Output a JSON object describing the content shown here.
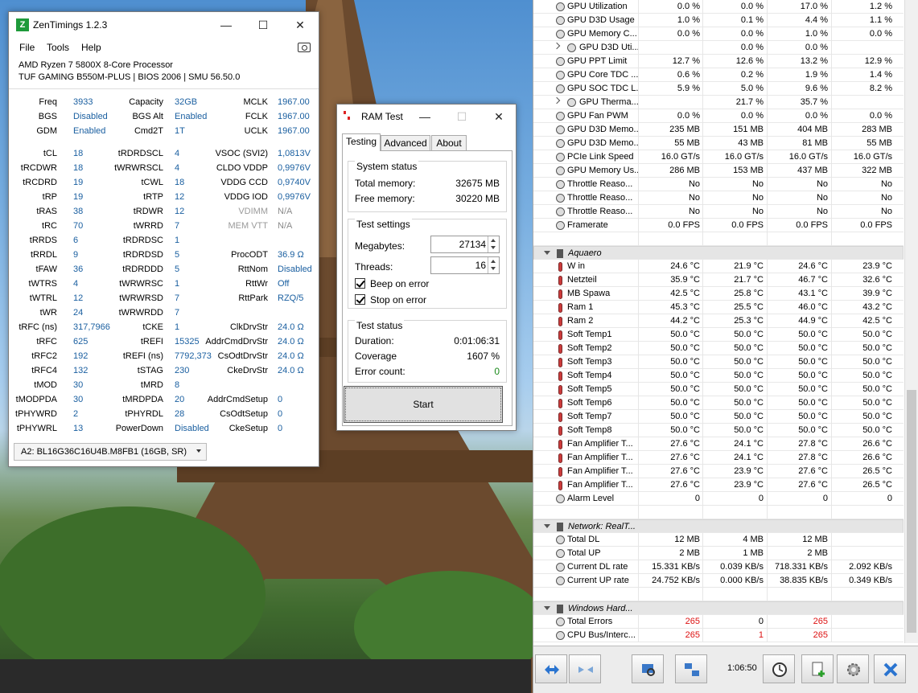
{
  "zen": {
    "title": "ZenTimings 1.2.3",
    "icon_letter": "Z",
    "menu": [
      "File",
      "Tools",
      "Help"
    ],
    "cpu": "AMD Ryzen 7 5800X 8-Core Processor",
    "board": "TUF GAMING B550M-PLUS | BIOS 2006 | SMU 56.50.0",
    "rows": [
      [
        "Freq",
        "3933",
        "Capacity",
        "32GB",
        "MCLK",
        "1967.00"
      ],
      [
        "BGS",
        "Disabled",
        "BGS Alt",
        "Enabled",
        "FCLK",
        "1967.00"
      ],
      [
        "GDM",
        "Enabled",
        "Cmd2T",
        "1T",
        "UCLK",
        "1967.00"
      ],
      [
        "tCL",
        "18",
        "tRDRDSCL",
        "4",
        "VSOC (SVI2)",
        "1,0813V"
      ],
      [
        "tRCDWR",
        "18",
        "tWRWRSCL",
        "4",
        "CLDO VDDP",
        "0,9976V"
      ],
      [
        "tRCDRD",
        "19",
        "tCWL",
        "18",
        "VDDG CCD",
        "0,9740V"
      ],
      [
        "tRP",
        "19",
        "tRTP",
        "12",
        "VDDG IOD",
        "0,9976V"
      ],
      [
        "tRAS",
        "38",
        "tRDWR",
        "12",
        "VDIMM",
        "N/A"
      ],
      [
        "tRC",
        "70",
        "tWRRD",
        "7",
        "MEM VTT",
        "N/A"
      ],
      [
        "tRRDS",
        "6",
        "tRDRDSC",
        "1",
        "",
        ""
      ],
      [
        "tRRDL",
        "9",
        "tRDRDSD",
        "5",
        "ProcODT",
        "36.9 Ω"
      ],
      [
        "tFAW",
        "36",
        "tRDRDDD",
        "5",
        "RttNom",
        "Disabled"
      ],
      [
        "tWTRS",
        "4",
        "tWRWRSC",
        "1",
        "RttWr",
        "Off"
      ],
      [
        "tWTRL",
        "12",
        "tWRWRSD",
        "7",
        "RttPark",
        "RZQ/5"
      ],
      [
        "tWR",
        "24",
        "tWRWRDD",
        "7",
        "",
        ""
      ],
      [
        "tRFC (ns)",
        "317,7966",
        "tCKE",
        "1",
        "ClkDrvStr",
        "24.0 Ω"
      ],
      [
        "tRFC",
        "625",
        "tREFI",
        "15325",
        "AddrCmdDrvStr",
        "24.0 Ω"
      ],
      [
        "tRFC2",
        "192",
        "tREFI (ns)",
        "7792,373",
        "CsOdtDrvStr",
        "24.0 Ω"
      ],
      [
        "tRFC4",
        "132",
        "tSTAG",
        "230",
        "CkeDrvStr",
        "24.0 Ω"
      ],
      [
        "tMOD",
        "30",
        "tMRD",
        "8",
        "",
        ""
      ],
      [
        "tMODPDA",
        "30",
        "tMRDPDA",
        "20",
        "AddrCmdSetup",
        "0"
      ],
      [
        "tPHYWRD",
        "2",
        "tPHYRDL",
        "28",
        "CsOdtSetup",
        "0"
      ],
      [
        "tPHYWRL",
        "13",
        "PowerDown",
        "Disabled",
        "CkeSetup",
        "0"
      ]
    ],
    "dimm": "A2: BL16G36C16U4B.M8FB1 (16GB, SR)"
  },
  "ram": {
    "title": "RAM Test",
    "tabs": [
      "Testing",
      "Advanced",
      "About"
    ],
    "system_status": "System status",
    "total_memory_label": "Total memory:",
    "total_memory": "32675 MB",
    "free_memory_label": "Free memory:",
    "free_memory": "30220 MB",
    "test_settings": "Test settings",
    "megabytes_label": "Megabytes:",
    "megabytes": "27134",
    "threads_label": "Threads:",
    "threads": "16",
    "beep": "Beep on error",
    "stop": "Stop on error",
    "test_status": "Test status",
    "duration_label": "Duration:",
    "duration": "0:01:06:31",
    "coverage_label": "Coverage",
    "coverage": "1607 %",
    "errors_label": "Error count:",
    "errors": "0",
    "start": "Start"
  },
  "hw": {
    "rows": [
      {
        "kind": "circ",
        "name": "GPU Utilization",
        "v": [
          "0.0 %",
          "0.0 %",
          "17.0 %",
          "1.2 %"
        ]
      },
      {
        "kind": "circ",
        "name": "GPU D3D Usage",
        "v": [
          "1.0 %",
          "0.1 %",
          "4.4 %",
          "1.1 %"
        ]
      },
      {
        "kind": "circ",
        "name": "GPU Memory C...",
        "v": [
          "0.0 %",
          "0.0 %",
          "1.0 %",
          "0.0 %"
        ]
      },
      {
        "kind": "sub",
        "name": "GPU D3D Uti...",
        "v": [
          "",
          "0.0 %",
          "0.0 %",
          ""
        ]
      },
      {
        "kind": "circ",
        "name": "GPU PPT Limit",
        "v": [
          "12.7 %",
          "12.6 %",
          "13.2 %",
          "12.9 %"
        ]
      },
      {
        "kind": "circ",
        "name": "GPU Core TDC ...",
        "v": [
          "0.6 %",
          "0.2 %",
          "1.9 %",
          "1.4 %"
        ]
      },
      {
        "kind": "circ",
        "name": "GPU SOC TDC L...",
        "v": [
          "5.9 %",
          "5.0 %",
          "9.6 %",
          "8.2 %"
        ]
      },
      {
        "kind": "sub",
        "name": "GPU Therma...",
        "v": [
          "",
          "21.7 %",
          "35.7 %",
          ""
        ]
      },
      {
        "kind": "circ",
        "name": "GPU Fan PWM",
        "v": [
          "0.0 %",
          "0.0 %",
          "0.0 %",
          "0.0 %"
        ]
      },
      {
        "kind": "circ",
        "name": "GPU D3D Memo...",
        "v": [
          "235 MB",
          "151 MB",
          "404 MB",
          "283 MB"
        ]
      },
      {
        "kind": "circ",
        "name": "GPU D3D Memo...",
        "v": [
          "55 MB",
          "43 MB",
          "81 MB",
          "55 MB"
        ]
      },
      {
        "kind": "circ",
        "name": "PCIe Link Speed",
        "v": [
          "16.0 GT/s",
          "16.0 GT/s",
          "16.0 GT/s",
          "16.0 GT/s"
        ]
      },
      {
        "kind": "circ",
        "name": "GPU Memory Us...",
        "v": [
          "286 MB",
          "153 MB",
          "437 MB",
          "322 MB"
        ]
      },
      {
        "kind": "circ",
        "name": "Throttle Reaso...",
        "v": [
          "No",
          "No",
          "No",
          "No"
        ]
      },
      {
        "kind": "circ",
        "name": "Throttle Reaso...",
        "v": [
          "No",
          "No",
          "No",
          "No"
        ]
      },
      {
        "kind": "circ",
        "name": "Throttle Reaso...",
        "v": [
          "No",
          "No",
          "No",
          "No"
        ]
      },
      {
        "kind": "circ",
        "name": "Framerate",
        "v": [
          "0.0 FPS",
          "0.0 FPS",
          "0.0 FPS",
          "0.0 FPS"
        ]
      },
      {
        "kind": "blank",
        "name": "",
        "v": [
          "",
          "",
          "",
          ""
        ]
      },
      {
        "kind": "group",
        "name": "Aquaero",
        "v": [
          "",
          "",
          "",
          ""
        ]
      },
      {
        "kind": "therm",
        "name": "W in",
        "v": [
          "24.6 °C",
          "21.9 °C",
          "24.6 °C",
          "23.9 °C"
        ]
      },
      {
        "kind": "therm",
        "name": "Netzteil",
        "v": [
          "35.9 °C",
          "21.7 °C",
          "46.7 °C",
          "32.6 °C"
        ]
      },
      {
        "kind": "therm",
        "name": "MB Spawa",
        "v": [
          "42.5 °C",
          "25.8 °C",
          "43.1 °C",
          "39.9 °C"
        ]
      },
      {
        "kind": "therm",
        "name": "Ram 1",
        "v": [
          "45.3 °C",
          "25.5 °C",
          "46.0 °C",
          "43.2 °C"
        ]
      },
      {
        "kind": "therm",
        "name": "Ram 2",
        "v": [
          "44.2 °C",
          "25.3 °C",
          "44.9 °C",
          "42.5 °C"
        ]
      },
      {
        "kind": "therm",
        "name": "Soft Temp1",
        "v": [
          "50.0 °C",
          "50.0 °C",
          "50.0 °C",
          "50.0 °C"
        ]
      },
      {
        "kind": "therm",
        "name": "Soft Temp2",
        "v": [
          "50.0 °C",
          "50.0 °C",
          "50.0 °C",
          "50.0 °C"
        ]
      },
      {
        "kind": "therm",
        "name": "Soft Temp3",
        "v": [
          "50.0 °C",
          "50.0 °C",
          "50.0 °C",
          "50.0 °C"
        ]
      },
      {
        "kind": "therm",
        "name": "Soft Temp4",
        "v": [
          "50.0 °C",
          "50.0 °C",
          "50.0 °C",
          "50.0 °C"
        ]
      },
      {
        "kind": "therm",
        "name": "Soft Temp5",
        "v": [
          "50.0 °C",
          "50.0 °C",
          "50.0 °C",
          "50.0 °C"
        ]
      },
      {
        "kind": "therm",
        "name": "Soft Temp6",
        "v": [
          "50.0 °C",
          "50.0 °C",
          "50.0 °C",
          "50.0 °C"
        ]
      },
      {
        "kind": "therm",
        "name": "Soft Temp7",
        "v": [
          "50.0 °C",
          "50.0 °C",
          "50.0 °C",
          "50.0 °C"
        ]
      },
      {
        "kind": "therm",
        "name": "Soft Temp8",
        "v": [
          "50.0 °C",
          "50.0 °C",
          "50.0 °C",
          "50.0 °C"
        ]
      },
      {
        "kind": "therm",
        "name": "Fan Amplifier T...",
        "v": [
          "27.6 °C",
          "24.1 °C",
          "27.8 °C",
          "26.6 °C"
        ]
      },
      {
        "kind": "therm",
        "name": "Fan Amplifier T...",
        "v": [
          "27.6 °C",
          "24.1 °C",
          "27.8 °C",
          "26.6 °C"
        ]
      },
      {
        "kind": "therm",
        "name": "Fan Amplifier T...",
        "v": [
          "27.6 °C",
          "23.9 °C",
          "27.6 °C",
          "26.5 °C"
        ]
      },
      {
        "kind": "therm",
        "name": "Fan Amplifier T...",
        "v": [
          "27.6 °C",
          "23.9 °C",
          "27.6 °C",
          "26.5 °C"
        ]
      },
      {
        "kind": "circ",
        "name": "Alarm Level",
        "v": [
          "0",
          "0",
          "0",
          "0"
        ]
      },
      {
        "kind": "blank",
        "name": "",
        "v": [
          "",
          "",
          "",
          ""
        ]
      },
      {
        "kind": "group",
        "name": "Network: RealT...",
        "v": [
          "",
          "",
          "",
          ""
        ]
      },
      {
        "kind": "circ",
        "name": "Total DL",
        "v": [
          "12 MB",
          "4 MB",
          "12 MB",
          ""
        ]
      },
      {
        "kind": "circ",
        "name": "Total UP",
        "v": [
          "2 MB",
          "1 MB",
          "2 MB",
          ""
        ]
      },
      {
        "kind": "circ",
        "name": "Current DL rate",
        "v": [
          "15.331 KB/s",
          "0.039 KB/s",
          "718.331 KB/s",
          "2.092 KB/s"
        ]
      },
      {
        "kind": "circ",
        "name": "Current UP rate",
        "v": [
          "24.752 KB/s",
          "0.000 KB/s",
          "38.835 KB/s",
          "0.349 KB/s"
        ]
      },
      {
        "kind": "blank",
        "name": "",
        "v": [
          "",
          "",
          "",
          ""
        ]
      },
      {
        "kind": "group",
        "name": "Windows Hard...",
        "v": [
          "",
          "",
          "",
          ""
        ]
      },
      {
        "kind": "circ",
        "name": "Total Errors",
        "v": [
          "265",
          "0",
          "265",
          ""
        ],
        "red": true
      },
      {
        "kind": "circ",
        "name": "CPU Bus/Interc...",
        "v": [
          "265",
          "1",
          "265",
          ""
        ],
        "red": true
      }
    ],
    "clock": "1:06:50"
  },
  "colors": {
    "accent_blue": "#1a5fa0",
    "error_red": "#d11111",
    "zen_green": "#1e9a3a"
  }
}
